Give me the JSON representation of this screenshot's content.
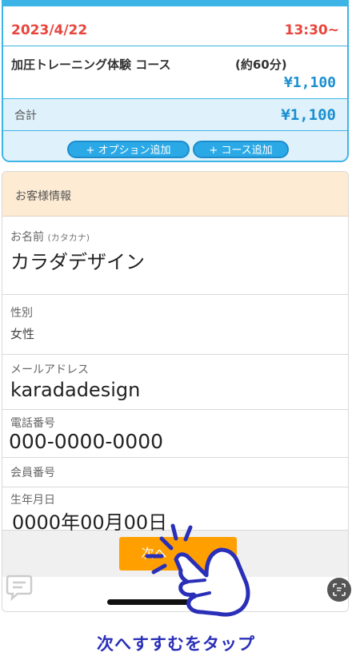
{
  "reservation": {
    "date": "2023/4/22",
    "time": "13:30~",
    "course_name": "加圧トレーニング体験 コース",
    "duration": "(約60分)",
    "course_price": "¥1,100",
    "total_label": "合計",
    "total_price": "¥1,100",
    "add_option_label": "+ オプション追加",
    "add_course_label": "+ コース追加"
  },
  "customer": {
    "section_title": "お客様情報",
    "name_label": "お名前",
    "name_label_note": "(カタカナ)",
    "name_value": "カラダデザイン",
    "gender_label": "性別",
    "gender_value": "女性",
    "email_label": "メールアドレス",
    "email_value": "karadadesign",
    "phone_label": "電話番号",
    "phone_value": "000-0000-0000",
    "member_label": "会員番号",
    "birth_label": "生年月日",
    "birth_value": "0000年00月00日"
  },
  "next_button_label": "次へ",
  "caption": "次へすすむをタップ",
  "icons": [
    "chat-icon",
    "scan-icon",
    "tap-hand-icon"
  ],
  "colors": {
    "accent_blue": "#3cb4e6",
    "date_red": "#e8453c",
    "price_blue": "#1a8fd0",
    "button_orange": "#ffa000",
    "caption_navy": "#2a2fb8",
    "info_header": "#fdebd3"
  }
}
